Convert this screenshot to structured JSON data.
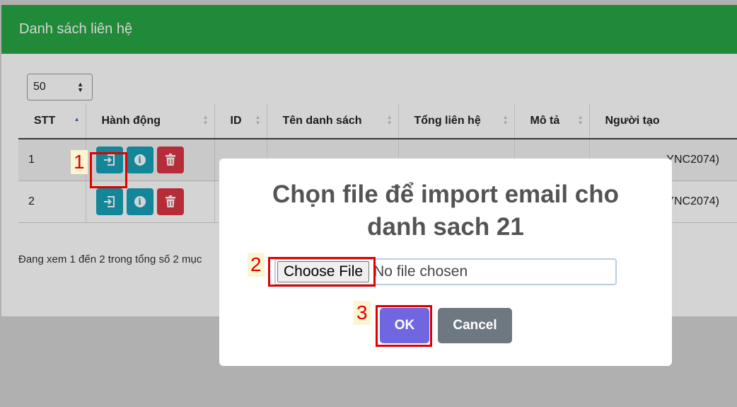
{
  "header": {
    "title": "Danh sách liên hệ"
  },
  "page_size": {
    "value": "50"
  },
  "table": {
    "columns": [
      "STT",
      "Hành động",
      "ID",
      "Tên danh sách",
      "Tổng liên hệ",
      "Mô tả",
      "Người tạo"
    ],
    "rows": [
      {
        "stt": "1",
        "creator_fragment": "YNC2074)"
      },
      {
        "stt": "2",
        "creator_fragment": "YNC2074)"
      }
    ]
  },
  "entries_info": "Đang xem 1 đến 2 trong tổng số 2 mục",
  "modal": {
    "title_line1": "Chọn file để import email cho",
    "title_line2": "danh sach 21",
    "choose_file_label": "Choose File",
    "no_file_text": "No file chosen",
    "ok_label": "OK",
    "cancel_label": "Cancel"
  },
  "annotations": {
    "step1": "1",
    "step2": "2",
    "step3": "3"
  },
  "colors": {
    "header_green": "#28a745",
    "teal": "#17a2b8",
    "red": "#dc3545",
    "ok_purple": "#7066e0",
    "cancel_gray": "#6e7881",
    "annotation_red": "#e00000"
  },
  "icons": [
    "import-icon",
    "info-icon",
    "trash-icon",
    "sort-icon",
    "select-arrow-icon"
  ]
}
